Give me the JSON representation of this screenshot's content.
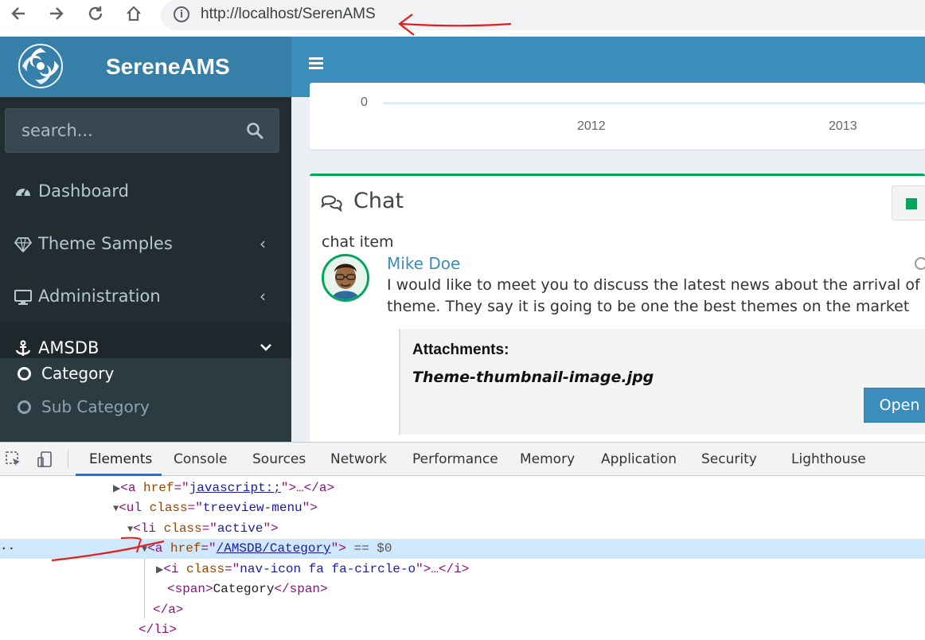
{
  "browser": {
    "url": "http://localhost/SerenAMS"
  },
  "header": {
    "brand": "SereneAMS"
  },
  "sidebar": {
    "search_placeholder": "search...",
    "items": [
      {
        "label": "Dashboard",
        "icon": "dashboard-icon"
      },
      {
        "label": "Theme Samples",
        "icon": "diamond-icon",
        "chevron": "‹"
      },
      {
        "label": "Administration",
        "icon": "desktop-icon",
        "chevron": "‹"
      },
      {
        "label": "AMSDB",
        "icon": "anchor-icon",
        "chevron": "⌄"
      }
    ],
    "subitems": [
      {
        "label": "Category",
        "active": true
      },
      {
        "label": "Sub Category",
        "active": false
      }
    ]
  },
  "chart": {
    "zero_label": "0",
    "x_ticks": [
      "2012",
      "2013"
    ]
  },
  "chart_data": {
    "type": "line",
    "categories": [
      "2012",
      "2013"
    ],
    "values": [
      0,
      0
    ],
    "title": "",
    "xlabel": "",
    "ylabel": ""
  },
  "chat": {
    "title": "Chat",
    "item_label": "chat item",
    "author": "Mike Doe",
    "message_line1": "I would like to meet you to discuss the latest news about the arrival of the n",
    "message_line2": "theme. They say it is going to be one the best themes on the market",
    "attachments_title": "Attachments:",
    "attachment_file": "Theme-thumbnail-image.jpg",
    "open_label": "Open",
    "status_color": "#00a65a"
  },
  "devtools": {
    "tabs": [
      "Elements",
      "Console",
      "Sources",
      "Network",
      "Performance",
      "Memory",
      "Application",
      "Security",
      "Lighthouse"
    ],
    "active_tab": "Elements",
    "lines": {
      "l1": {
        "tag_open": "<a ",
        "attr": "href",
        "eq": "=\"",
        "val": "javascript:;",
        "rest": "\">…</a>"
      },
      "l2": {
        "tag_open": "<ul ",
        "attr": "class",
        "eq": "=\"",
        "val": "treeview-menu",
        "rest": "\">"
      },
      "l3": {
        "tag_open": "<li ",
        "attr": "class",
        "eq": "=\"",
        "val": "active",
        "rest": "\">"
      },
      "l4": {
        "tag_open": "<a ",
        "attr": "href",
        "eq": "=\"",
        "val": "/AMSDB/Category",
        "rest": "\">",
        "selected": " == $0"
      },
      "l5": {
        "tag_open": "<i ",
        "attr": "class",
        "eq": "=\"",
        "val": "nav-icon fa fa-circle-o",
        "rest": "\">…</i>"
      },
      "l6": {
        "open": "<span>",
        "text": "Category",
        "close": "</span>"
      },
      "l7": {
        "text": "</a>"
      },
      "l8": {
        "text": "</li>"
      }
    },
    "ellipsis": "··"
  },
  "colors": {
    "sidebar_bg": "#222d32",
    "header_bg": "#3c8dbc",
    "logo_bg": "#367fa9",
    "accent_green": "#00a65a",
    "annotation_red": "#e31d1d"
  }
}
